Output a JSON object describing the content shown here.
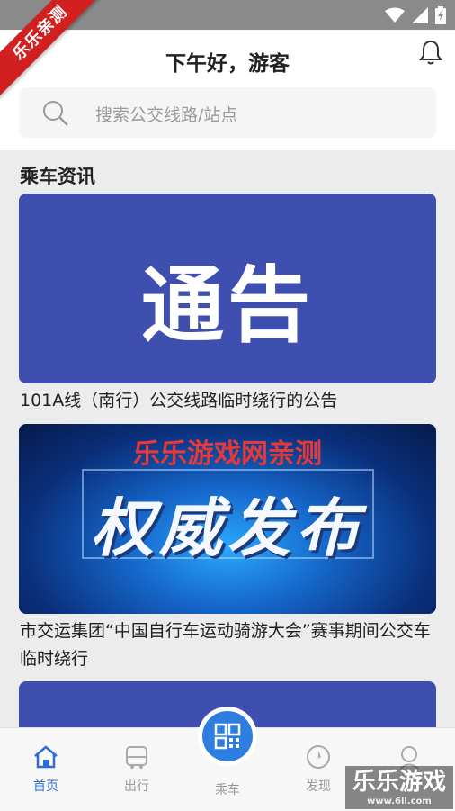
{
  "watermarks": {
    "ribbon": "乐乐亲测",
    "card_overlay": "乐乐游戏网亲测",
    "brand": "乐乐游戏",
    "brand_url": "www.6ll.com"
  },
  "header": {
    "greeting": "下午好，游客"
  },
  "search": {
    "placeholder": "搜索公交线路/站点"
  },
  "section": {
    "title": "乘车资讯"
  },
  "news": [
    {
      "image_text": "通告",
      "title": "101A线（南行）公交线路临时绕行的公告"
    },
    {
      "image_text": "权威发布",
      "title": "市交运集团“中国自行车运动骑游大会”赛事期间公交车临时绕行"
    },
    {
      "image_text": "",
      "title": ""
    }
  ],
  "tabbar": {
    "items": [
      {
        "label": "首页",
        "icon": "home-icon",
        "active": true
      },
      {
        "label": "出行",
        "icon": "bus-icon",
        "active": false
      },
      {
        "label": "乘车",
        "icon": "qr-code-icon",
        "active": false
      },
      {
        "label": "发现",
        "icon": "compass-icon",
        "active": false
      },
      {
        "label": "",
        "icon": "user-icon",
        "active": false
      }
    ]
  },
  "colors": {
    "accent": "#2b6cd8",
    "card_blue": "#3f4fb0",
    "status_bar": "#8a8a8a"
  }
}
